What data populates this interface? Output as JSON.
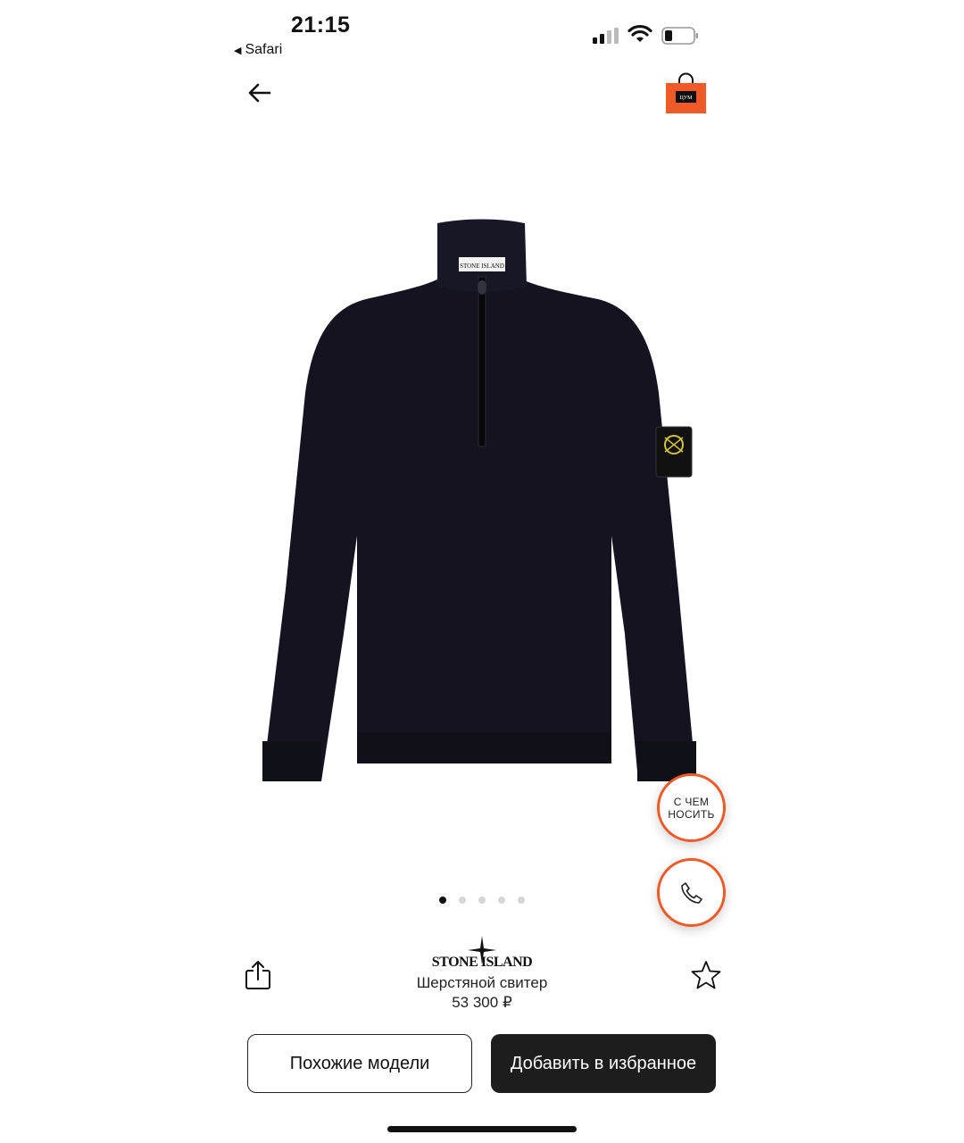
{
  "status_bar": {
    "time": "21:15",
    "back_app": "Safari",
    "icons": [
      "signal-icon",
      "wifi-icon",
      "battery-icon"
    ]
  },
  "nav": {
    "back_icon": "arrow-left-icon",
    "bag_icon": "shopping-bag-icon",
    "bag_logo_text": "TSUM"
  },
  "product": {
    "brand_logo_text": "STONE ISLAND",
    "name": "Шерстяной свитер",
    "price": "53 300 ₽",
    "image_description": "navy-sweater-image"
  },
  "carousel": {
    "total": 5,
    "active_index": 0
  },
  "floating": {
    "outfit_label_line1": "С ЧЕМ",
    "outfit_label_line2": "НОСИТЬ",
    "call_icon": "phone-icon"
  },
  "actions": {
    "similar_label": "Похожие модели",
    "favorite_label": "Добавить в избранное",
    "share_icon": "share-icon",
    "star_icon": "star-icon"
  },
  "colors": {
    "accent": "#f05a28",
    "dark_button": "#1d1d1d",
    "sweater": "#14131f"
  }
}
